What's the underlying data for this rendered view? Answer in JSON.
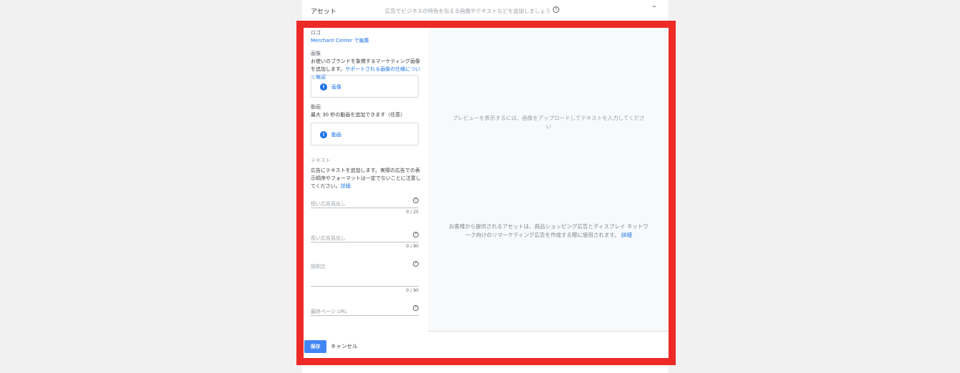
{
  "header": {
    "title": "アセット",
    "description": "広告でビジネスの特色を伝える画像やテキストなどを追加しましょう",
    "help_glyph": "?",
    "chevron_glyph": "⌃"
  },
  "form": {
    "logo_label": "ロゴ",
    "logo_link": "Merchant Center で編集",
    "image_label": "画像",
    "image_desc": "お使いのブランドを象徴するマーケティング画像を追加します。",
    "image_desc_link": "サポートされる画像の仕様について確認",
    "image_upload": "画像",
    "video_label": "動画",
    "video_desc": "最大 30 秒の動画を追加できます（任意）",
    "video_upload": "動画",
    "text_label": "テキスト",
    "text_desc": "広告にテキストを追加します。実際の広告での表示順序やフォーマットは一定でないことに注意してください。",
    "text_desc_link": "詳細",
    "short_headline": "短い広告見出し",
    "short_counter": "0 / 25",
    "long_headline": "長い広告見出し",
    "long_counter": "0 / 90",
    "description": "説明文",
    "description_counter": "0 / 90",
    "final_url": "最終ページ URL"
  },
  "preview": {
    "message": "プレビューを表示するには、画像をアップロードしてテキストを入力してください",
    "info": "お客様から提供されるアセットは、商品ショッピング広告とディスプレイ ネットワーク向けのリマーケティング広告を作成する際に使用されます。",
    "info_link": "詳細"
  },
  "footer": {
    "save": "保存",
    "cancel": "キャンセル"
  },
  "colors": {
    "accent": "#1a73e8",
    "save_button": "#4285f4",
    "highlight": "#ee2a27"
  },
  "icons": {
    "upload": "info-circle-icon"
  }
}
